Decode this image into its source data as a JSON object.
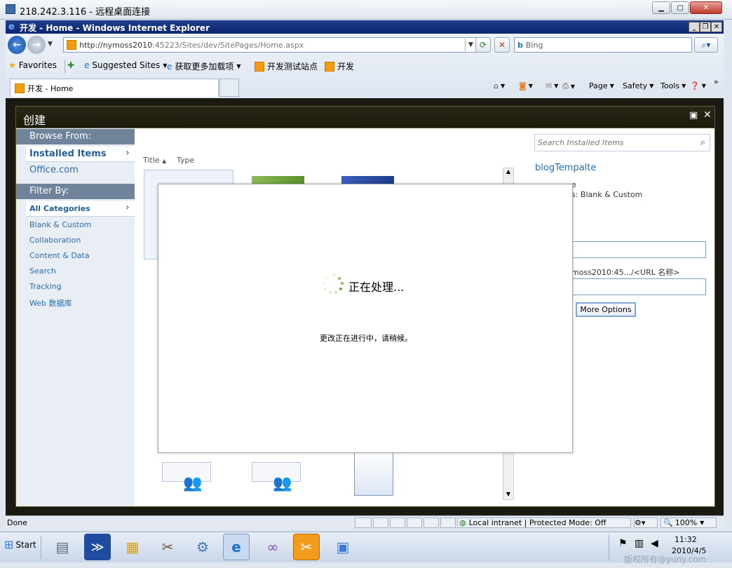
{
  "rdp_title": "218.242.3.116 - 远程桌面连接",
  "ie_title": "开发 - Home - Windows Internet Explorer",
  "address": {
    "prefix": "http://nymoss2010",
    "rest": ":45223/Sites/dev/SitePages/Home.aspx"
  },
  "search": {
    "placeholder": "Bing"
  },
  "favorites": {
    "favorites_label": "Favorites",
    "suggested": "Suggested Sites",
    "addons": "获取更多加载项",
    "test_site": "开发测试站点",
    "dev": "开发"
  },
  "tab": {
    "label": "开发 - Home"
  },
  "commands": {
    "page": "Page",
    "safety": "Safety",
    "tools": "Tools"
  },
  "dialog": {
    "title": "创建",
    "browse_from": "Browse From:",
    "installed_items": "Installed Items",
    "office": "Office.com",
    "filter_by": "Filter By:",
    "categories": [
      "All Categories",
      "Blank & Custom",
      "Collaboration",
      "Content & Data",
      "Search",
      "Tracking",
      "Web 数据库"
    ],
    "col_title": "Title",
    "col_type": "Type",
    "search_placeholder": "Search Installed Items",
    "template_name": "blogTempalte",
    "type_line_partial": "e",
    "categories_line_partial": "s: Blank & Custom",
    "url_hint_partial": "moss2010:45.../<URL 名称>",
    "more_options": "More Options"
  },
  "modal": {
    "title": "正在处理...",
    "message": "更改正在进行中，请稍候。"
  },
  "status": {
    "done": "Done",
    "zone": "Local intranet | Protected Mode: Off",
    "zoom": "100%"
  },
  "taskbar": {
    "start": "Start",
    "time": "11:32",
    "date": "2010/4/5",
    "watermark": "版权所有@yuny.com"
  }
}
